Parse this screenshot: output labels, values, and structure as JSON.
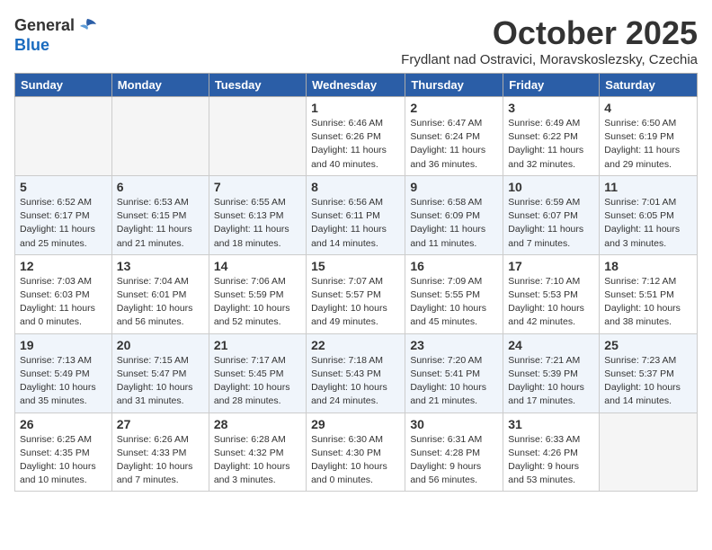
{
  "logo": {
    "general": "General",
    "blue": "Blue"
  },
  "title": "October 2025",
  "location": "Frydlant nad Ostravici, Moravskoslezsky, Czechia",
  "days_of_week": [
    "Sunday",
    "Monday",
    "Tuesday",
    "Wednesday",
    "Thursday",
    "Friday",
    "Saturday"
  ],
  "weeks": [
    [
      {
        "day": "",
        "info": ""
      },
      {
        "day": "",
        "info": ""
      },
      {
        "day": "",
        "info": ""
      },
      {
        "day": "1",
        "info": "Sunrise: 6:46 AM\nSunset: 6:26 PM\nDaylight: 11 hours\nand 40 minutes."
      },
      {
        "day": "2",
        "info": "Sunrise: 6:47 AM\nSunset: 6:24 PM\nDaylight: 11 hours\nand 36 minutes."
      },
      {
        "day": "3",
        "info": "Sunrise: 6:49 AM\nSunset: 6:22 PM\nDaylight: 11 hours\nand 32 minutes."
      },
      {
        "day": "4",
        "info": "Sunrise: 6:50 AM\nSunset: 6:19 PM\nDaylight: 11 hours\nand 29 minutes."
      }
    ],
    [
      {
        "day": "5",
        "info": "Sunrise: 6:52 AM\nSunset: 6:17 PM\nDaylight: 11 hours\nand 25 minutes."
      },
      {
        "day": "6",
        "info": "Sunrise: 6:53 AM\nSunset: 6:15 PM\nDaylight: 11 hours\nand 21 minutes."
      },
      {
        "day": "7",
        "info": "Sunrise: 6:55 AM\nSunset: 6:13 PM\nDaylight: 11 hours\nand 18 minutes."
      },
      {
        "day": "8",
        "info": "Sunrise: 6:56 AM\nSunset: 6:11 PM\nDaylight: 11 hours\nand 14 minutes."
      },
      {
        "day": "9",
        "info": "Sunrise: 6:58 AM\nSunset: 6:09 PM\nDaylight: 11 hours\nand 11 minutes."
      },
      {
        "day": "10",
        "info": "Sunrise: 6:59 AM\nSunset: 6:07 PM\nDaylight: 11 hours\nand 7 minutes."
      },
      {
        "day": "11",
        "info": "Sunrise: 7:01 AM\nSunset: 6:05 PM\nDaylight: 11 hours\nand 3 minutes."
      }
    ],
    [
      {
        "day": "12",
        "info": "Sunrise: 7:03 AM\nSunset: 6:03 PM\nDaylight: 11 hours\nand 0 minutes."
      },
      {
        "day": "13",
        "info": "Sunrise: 7:04 AM\nSunset: 6:01 PM\nDaylight: 10 hours\nand 56 minutes."
      },
      {
        "day": "14",
        "info": "Sunrise: 7:06 AM\nSunset: 5:59 PM\nDaylight: 10 hours\nand 52 minutes."
      },
      {
        "day": "15",
        "info": "Sunrise: 7:07 AM\nSunset: 5:57 PM\nDaylight: 10 hours\nand 49 minutes."
      },
      {
        "day": "16",
        "info": "Sunrise: 7:09 AM\nSunset: 5:55 PM\nDaylight: 10 hours\nand 45 minutes."
      },
      {
        "day": "17",
        "info": "Sunrise: 7:10 AM\nSunset: 5:53 PM\nDaylight: 10 hours\nand 42 minutes."
      },
      {
        "day": "18",
        "info": "Sunrise: 7:12 AM\nSunset: 5:51 PM\nDaylight: 10 hours\nand 38 minutes."
      }
    ],
    [
      {
        "day": "19",
        "info": "Sunrise: 7:13 AM\nSunset: 5:49 PM\nDaylight: 10 hours\nand 35 minutes."
      },
      {
        "day": "20",
        "info": "Sunrise: 7:15 AM\nSunset: 5:47 PM\nDaylight: 10 hours\nand 31 minutes."
      },
      {
        "day": "21",
        "info": "Sunrise: 7:17 AM\nSunset: 5:45 PM\nDaylight: 10 hours\nand 28 minutes."
      },
      {
        "day": "22",
        "info": "Sunrise: 7:18 AM\nSunset: 5:43 PM\nDaylight: 10 hours\nand 24 minutes."
      },
      {
        "day": "23",
        "info": "Sunrise: 7:20 AM\nSunset: 5:41 PM\nDaylight: 10 hours\nand 21 minutes."
      },
      {
        "day": "24",
        "info": "Sunrise: 7:21 AM\nSunset: 5:39 PM\nDaylight: 10 hours\nand 17 minutes."
      },
      {
        "day": "25",
        "info": "Sunrise: 7:23 AM\nSunset: 5:37 PM\nDaylight: 10 hours\nand 14 minutes."
      }
    ],
    [
      {
        "day": "26",
        "info": "Sunrise: 6:25 AM\nSunset: 4:35 PM\nDaylight: 10 hours\nand 10 minutes."
      },
      {
        "day": "27",
        "info": "Sunrise: 6:26 AM\nSunset: 4:33 PM\nDaylight: 10 hours\nand 7 minutes."
      },
      {
        "day": "28",
        "info": "Sunrise: 6:28 AM\nSunset: 4:32 PM\nDaylight: 10 hours\nand 3 minutes."
      },
      {
        "day": "29",
        "info": "Sunrise: 6:30 AM\nSunset: 4:30 PM\nDaylight: 10 hours\nand 0 minutes."
      },
      {
        "day": "30",
        "info": "Sunrise: 6:31 AM\nSunset: 4:28 PM\nDaylight: 9 hours\nand 56 minutes."
      },
      {
        "day": "31",
        "info": "Sunrise: 6:33 AM\nSunset: 4:26 PM\nDaylight: 9 hours\nand 53 minutes."
      },
      {
        "day": "",
        "info": ""
      }
    ]
  ]
}
